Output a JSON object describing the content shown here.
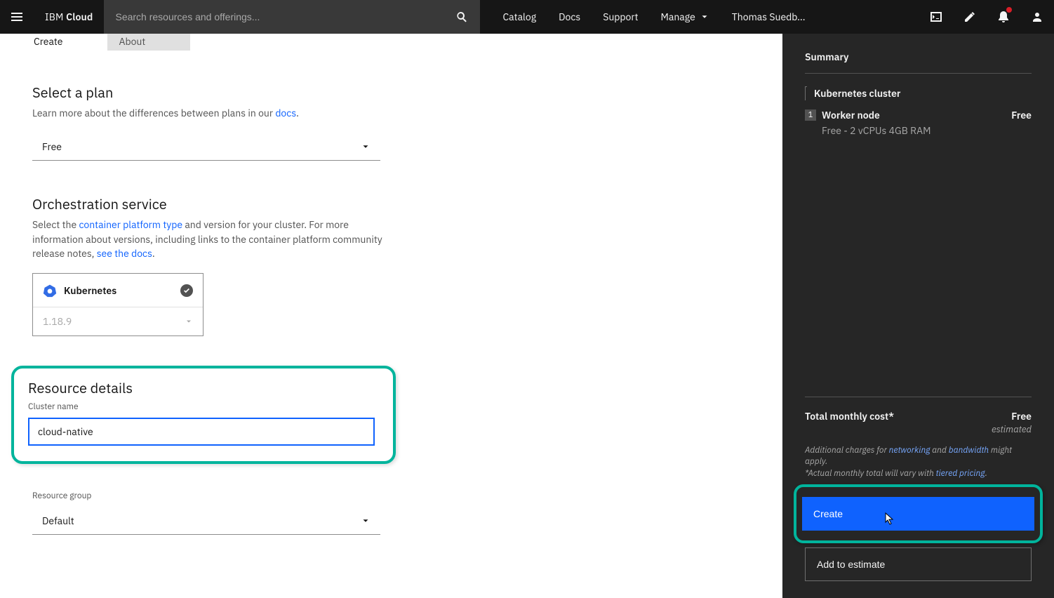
{
  "header": {
    "brand_prefix": "IBM ",
    "brand_bold": "Cloud",
    "search_placeholder": "Search resources and offerings...",
    "nav": {
      "catalog": "Catalog",
      "docs": "Docs",
      "support": "Support",
      "manage": "Manage",
      "user": "Thomas Suedb..."
    }
  },
  "tabs": {
    "create": "Create",
    "about": "About"
  },
  "plan": {
    "title": "Select a plan",
    "subtitle_pre": "Learn more about the differences between plans in our ",
    "subtitle_link": "docs",
    "subtitle_post": ".",
    "selected": "Free"
  },
  "orch": {
    "title": "Orchestration service",
    "sub_pre": "Select the ",
    "sub_link1": "container platform type",
    "sub_mid": " and version for your cluster. For more information about versions, including links to the container platform community release notes, ",
    "sub_link2": "see the docs",
    "sub_post": ".",
    "option_label": "Kubernetes",
    "version": "1.18.9"
  },
  "resource": {
    "title": "Resource details",
    "cluster_label": "Cluster name",
    "cluster_value": "cloud-native",
    "group_label": "Resource group",
    "group_value": "Default"
  },
  "summary": {
    "title": "Summary",
    "cluster": "Kubernetes cluster",
    "worker_count": "1",
    "worker_label": "Worker node",
    "worker_price": "Free",
    "worker_desc": "Free - 2 vCPUs 4GB RAM",
    "total_label": "Total monthly cost*",
    "total_price": "Free",
    "total_est": "estimated",
    "fine_pre": "Additional charges for ",
    "fine_link1": "networking",
    "fine_mid1": " and ",
    "fine_link2": "bandwidth",
    "fine_mid2": " might apply.",
    "fine2_pre": "*Actual monthly total will vary with ",
    "fine2_link": "tiered pricing",
    "fine2_post": ".",
    "create_btn": "Create",
    "estimate_btn": "Add to estimate"
  }
}
